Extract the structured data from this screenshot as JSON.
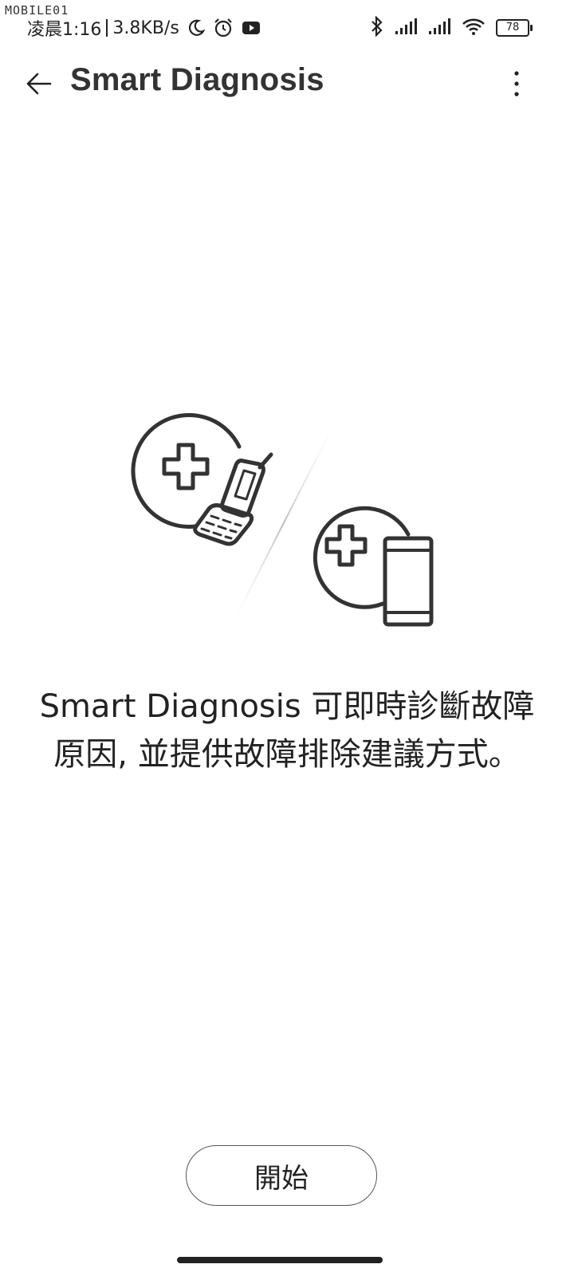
{
  "status_bar": {
    "watermark": "MOBILE01",
    "time": "凌晨1:16",
    "speed": "3.8KB/s",
    "battery": "78",
    "icons": [
      "moon-icon",
      "alarm-icon",
      "youtube-icon",
      "bluetooth-icon",
      "signal-icon",
      "signal-icon",
      "wifi-icon",
      "battery-icon"
    ]
  },
  "app_bar": {
    "title": "Smart Diagnosis",
    "back_icon": "back-arrow-icon",
    "menu_icon": "more-vert-icon"
  },
  "illustration": {
    "icons": [
      "diagnosis-flip-phone-icon",
      "diagnosis-smartphone-icon"
    ]
  },
  "description": "Smart Diagnosis 可即時診斷故障原因, 並提供故障排除建議方式。",
  "start_button_label": "開始",
  "colors": {
    "text": "#222222",
    "background": "#ffffff",
    "icon_stroke": "#333333"
  }
}
